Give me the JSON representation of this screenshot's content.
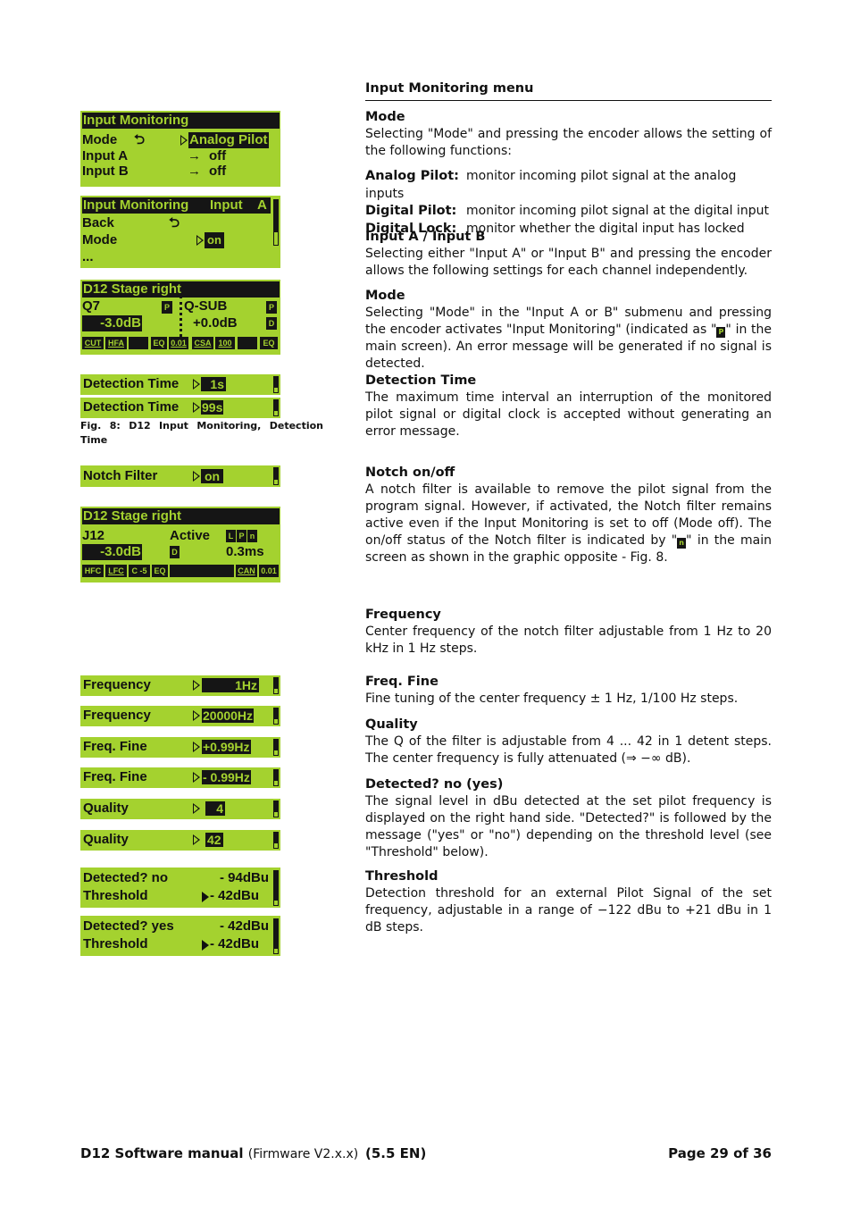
{
  "section_title": "Input Monitoring menu",
  "lcd": {
    "im_main": {
      "title": "Input Monitoring",
      "rows": [
        {
          "label": "Mode",
          "value": "Analog Pilot"
        },
        {
          "label": "Input A",
          "value": "off"
        },
        {
          "label": "Input B",
          "value": "off"
        }
      ]
    },
    "im_input": {
      "title": "Input Monitoring",
      "title_right": "Input",
      "channel": "A",
      "rows": [
        {
          "label": "Back"
        },
        {
          "label": "Mode",
          "value": "on"
        },
        {
          "label": "..."
        }
      ]
    },
    "main1": {
      "title": "D12 Stage right",
      "left_name": "Q7",
      "left_flag": "P",
      "left_gain": "-3.0dB",
      "right_name": "Q-SUB",
      "right_flag1": "P",
      "right_flag2": "D",
      "right_gain": "+0.0dB",
      "tags": [
        "CUT",
        "HFA",
        "",
        "EQ",
        "0.01",
        "CSA",
        "100",
        "",
        "EQ"
      ]
    },
    "detection": [
      {
        "label": "Detection Time",
        "value": "1s"
      },
      {
        "label": "Detection Time",
        "value": "99s"
      }
    ],
    "notch": {
      "label": "Notch Filter",
      "value": "on"
    },
    "main2": {
      "title": "D12 Stage right",
      "name": "J12",
      "status": "Active",
      "flags": [
        "L",
        "P",
        "n"
      ],
      "gain": "-3.0dB",
      "flag_d": "D",
      "delay": "0.3ms",
      "tags": [
        "HFC",
        "LFC",
        "C -5",
        "EQ",
        "",
        "CAN",
        "0.01"
      ]
    },
    "params": [
      {
        "label": "Frequency",
        "value": "1Hz"
      },
      {
        "label": "Frequency",
        "value": "20000Hz"
      },
      {
        "label": "Freq. Fine",
        "value": "+0.99Hz"
      },
      {
        "label": "Freq. Fine",
        "value": "- 0.99Hz"
      },
      {
        "label": "Quality",
        "value": "4"
      },
      {
        "label": "Quality",
        "value": "42"
      }
    ],
    "detect": [
      {
        "label1": "Detected? no",
        "value1": "- 94dBu",
        "label2": "Threshold",
        "value2": "- 42dBu"
      },
      {
        "label1": "Detected? yes",
        "value1": "- 42dBu",
        "label2": "Threshold",
        "value2": "- 42dBu"
      }
    ]
  },
  "figure_caption": "Fig. 8: D12 Input Monitoring, Detection Time",
  "text": {
    "mode_h": "Mode",
    "mode_p": "Selecting \"Mode\" and pressing the encoder allows the setting of the following functions:",
    "functions": [
      {
        "key": "Analog Pilot:",
        "desc": "monitor incoming pilot signal at the analog inputs"
      },
      {
        "key": "Digital Pilot:",
        "desc": "monitor incoming pilot signal at the digital input"
      },
      {
        "key": "Digital Lock:",
        "desc": "monitor whether the digital input has locked"
      }
    ],
    "inputab_h": "Input A / Input B",
    "inputab_p": "Selecting either \"Input A\" or \"Input B\" and pressing the encoder allows the following settings for each channel independently.",
    "mode2_h": "Mode",
    "mode2_p1": "Selecting \"Mode\" in the \"Input A or B\" submenu and pressing the encoder activates \"Input Monitoring\" (indicated as \"",
    "mode2_icon": "P",
    "mode2_p2": "\" in the main screen). An error message will be generated if no signal is detected.",
    "dettime_h": "Detection Time",
    "dettime_p": "The maximum time interval an interruption of the monitored pilot signal or digital clock is accepted without generating an error message.",
    "notch_h": "Notch on/off",
    "notch_p1": "A notch filter is available to remove the pilot signal from the program signal. However, if activated, the Notch filter remains active even if the Input Monitoring is set to off (Mode off). The on/off status of the Notch filter is indicated by \"",
    "notch_icon": "n",
    "notch_p2": "\" in the main screen as shown in the graphic opposite - Fig. 8.",
    "freq_h": "Frequency",
    "freq_p": "Center frequency of the notch filter adjustable from 1 Hz to 20 kHz in 1 Hz steps.",
    "fine_h": "Freq. Fine",
    "fine_p": "Fine tuning of the center frequency ± 1 Hz, 1/100 Hz steps.",
    "quality_h": "Quality",
    "quality_p": "The Q of the filter is adjustable from 4 ... 42 in 1 detent steps. The center frequency is fully attenuated (⇒ −∞  dB).",
    "detected_h": "Detected? no (yes)",
    "detected_p": "The signal level in dBu detected at the set pilot frequency is displayed on the right hand side. \"Detected?\" is followed by the message (\"yes\" or \"no\") depending on the threshold level (see \"Threshold\" below).",
    "threshold_h": "Threshold",
    "threshold_p": "Detection threshold for an external Pilot Signal of the set frequency, adjustable in a range of −122 dBu to +21 dBu in 1 dB steps."
  },
  "footer": {
    "title": "D12 Software manual",
    "firmware": "(Firmware V2.x.x)",
    "version": "(5.5 EN)",
    "page": "Page 29 of 36"
  }
}
